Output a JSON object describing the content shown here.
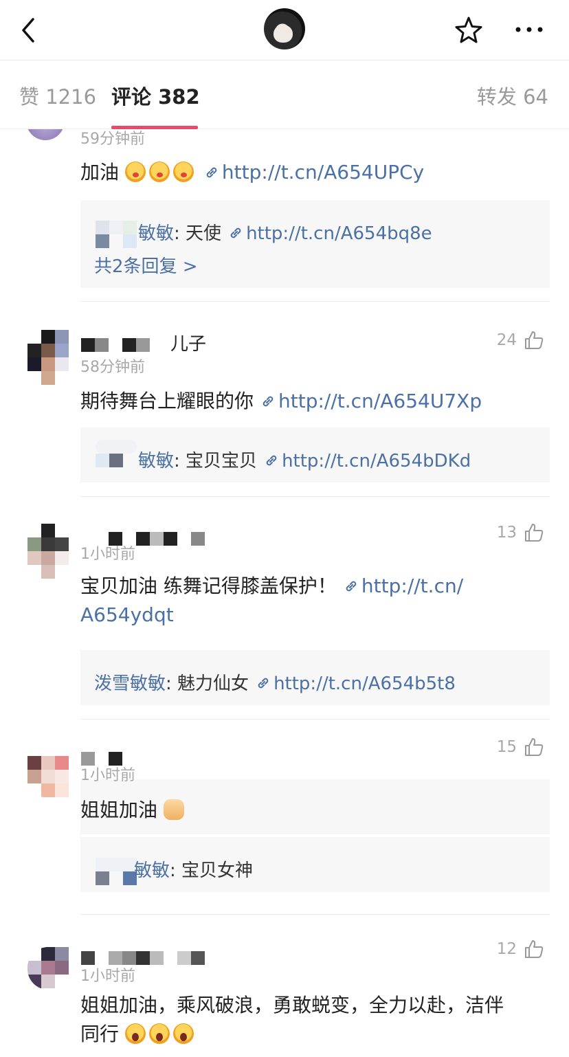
{
  "tabs": {
    "like": "赞 1216",
    "comment": "评论 382",
    "repost": "转发 64"
  },
  "icons": {
    "back": "chevron-left-icon",
    "star": "star-outline-icon",
    "more": "ellipsis-icon",
    "thumb": "thumbs-up-icon",
    "link": "link-icon"
  },
  "colors": {
    "accent": "#e9496a",
    "link": "#4a70a5",
    "muted": "#a8a8a8"
  },
  "comments": [
    {
      "time": "59分钟前",
      "text": "加油",
      "link": "http://t.cn/A654UPCy",
      "reply": {
        "name": "敏敏",
        "sep": ": ",
        "text": "天使",
        "link": "http://t.cn/A654bq8e",
        "more": "共2条回复 >"
      }
    },
    {
      "username": "儿子",
      "time": "58分钟前",
      "likes": "24",
      "text": "期待舞台上耀眼的你",
      "link": "http://t.cn/A654U7Xp",
      "reply": {
        "name": "敏敏",
        "sep": ": ",
        "text": "宝贝宝贝",
        "link": "http://t.cn/A654bDKd"
      }
    },
    {
      "time": "1小时前",
      "likes": "13",
      "text": "宝贝加油 练舞记得膝盖保护！",
      "link_part1": "http://t.cn/",
      "link_part2": "A654ydqt",
      "reply": {
        "name": "泼雪敏敏",
        "sep": ": ",
        "text": "魅力仙女",
        "link": "http://t.cn/A654b5t8"
      }
    },
    {
      "time": "1小时前",
      "likes": "15",
      "text": "姐姐加油",
      "reply": {
        "name": "敏敏",
        "sep": ": ",
        "text": "宝贝女神"
      }
    },
    {
      "time": "1小时前",
      "likes": "12",
      "text_line1": "姐姐加油，乘风破浪，勇敢蜕变，全力以赴，洁伴",
      "text_line2": "同行"
    }
  ]
}
